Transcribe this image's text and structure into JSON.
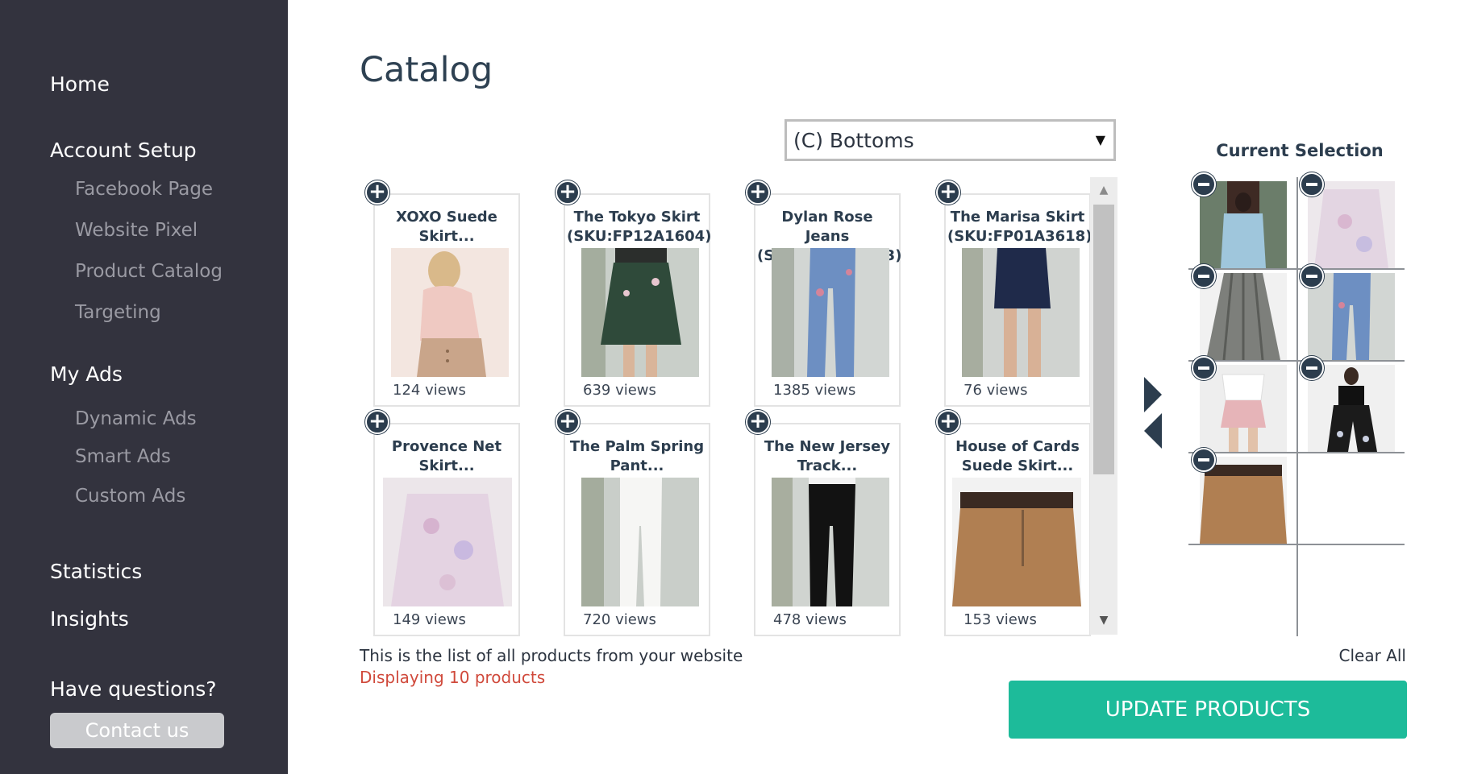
{
  "sidebar": {
    "home": "Home",
    "account_setup": "Account Setup",
    "account_items": [
      "Facebook Page",
      "Website Pixel",
      "Product Catalog",
      "Targeting"
    ],
    "my_ads": "My Ads",
    "ads_items": [
      "Dynamic Ads",
      "Smart Ads",
      "Custom Ads"
    ],
    "statistics": "Statistics",
    "insights": "Insights",
    "questions": "Have questions?",
    "contact": "Contact us"
  },
  "main": {
    "title": "Catalog",
    "category": {
      "selected": "(C) Bottoms"
    },
    "products": [
      {
        "title": "XOXO Suede Skirt...",
        "views": "124 views",
        "image": "pink-top-suede-skirt"
      },
      {
        "title": "The Tokyo Skirt (SKU:FP12A1604)",
        "views": "639 views",
        "image": "green-floral-skirt"
      },
      {
        "title": "Dylan Rose Jeans (SKU:FP01A1603)",
        "views": "1385 views",
        "image": "embroidered-jeans"
      },
      {
        "title": "The Marisa Skirt (SKU:FP01A3618)",
        "views": "76 views",
        "image": "navy-velvet-skirt"
      },
      {
        "title": "Provence Net Skirt...",
        "views": "149 views",
        "image": "floral-tulle-skirt"
      },
      {
        "title": "The Palm Spring Pant...",
        "views": "720 views",
        "image": "white-pants"
      },
      {
        "title": "The New Jersey Track...",
        "views": "478 views",
        "image": "black-track-pants"
      },
      {
        "title": "House of Cards Suede Skirt...",
        "views": "153 views",
        "image": "tan-suede-skirt"
      }
    ],
    "info": "This is the list of all products from your website",
    "count": "Displaying 10 products"
  },
  "selection": {
    "title": "Current Selection",
    "items": [
      "floral-jacket-outfit",
      "tulle-skirt",
      "pleated-metallic-skirt",
      "embroidered-jeans",
      "pink-shorts-outfit",
      "black-floral-pants",
      "tan-suede-skirt"
    ],
    "clear_all": "Clear All",
    "update": "UPDATE PRODUCTS"
  },
  "colors": {
    "sidebar_bg": "#33333e",
    "accent": "#1dbb9a",
    "heading": "#2c3d4e",
    "count_red": "#d0493b"
  }
}
